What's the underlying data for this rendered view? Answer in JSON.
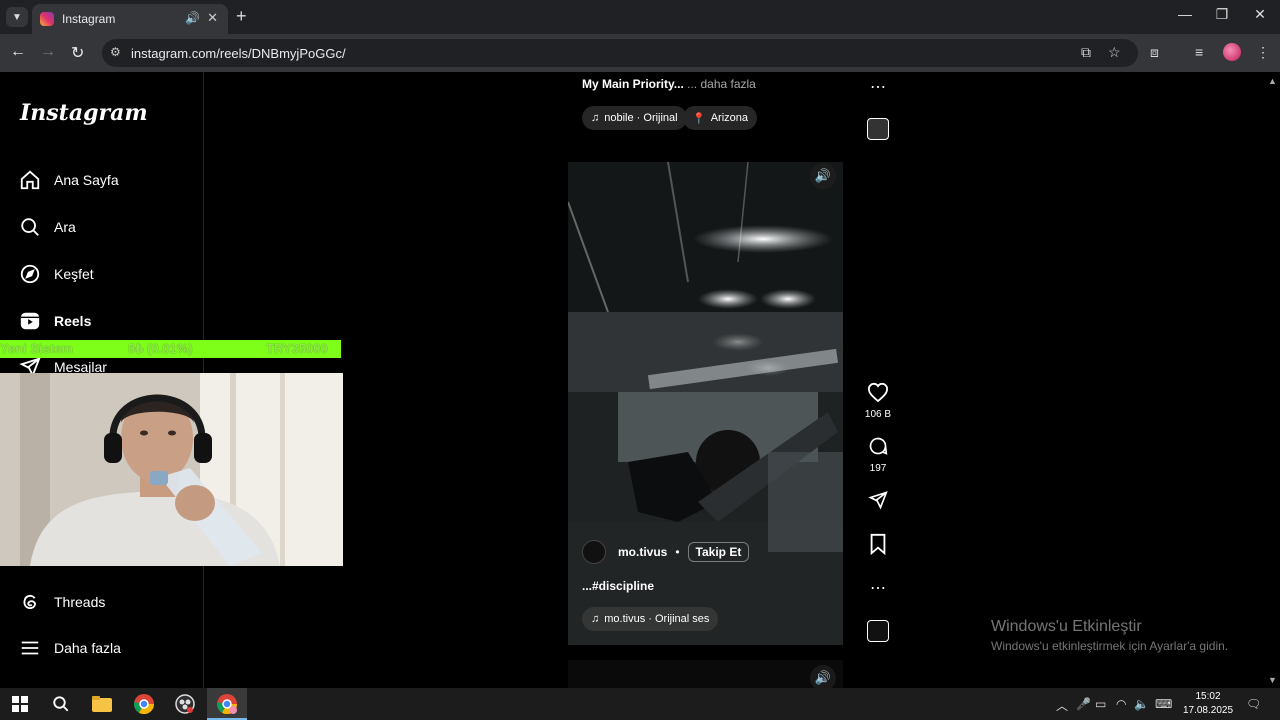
{
  "browser": {
    "tab_title": "Instagram",
    "tab_close": "✕",
    "new_tab": "+",
    "url": "instagram.com/reels/DNBmyjPoGGc/"
  },
  "sidebar": {
    "logo": "Instagram",
    "items": [
      {
        "label": "Ana Sayfa",
        "icon": "home-icon"
      },
      {
        "label": "Ara",
        "icon": "search-icon"
      },
      {
        "label": "Keşfet",
        "icon": "compass-icon"
      },
      {
        "label": "Reels",
        "icon": "reels-icon"
      },
      {
        "label": "Mesajlar",
        "icon": "send-icon"
      },
      {
        "label": "Threads",
        "icon": "threads-icon"
      },
      {
        "label": "Daha fazla",
        "icon": "menu-icon"
      }
    ]
  },
  "ticker": {
    "name": "Yeni Sistem",
    "change": "5₺ (0.01%)",
    "target": "TRY35000"
  },
  "reel_prev": {
    "caption": "My Main Priority... ",
    "more": "... daha fazla",
    "audio": "nobile · Orijinal",
    "location": "Arizona"
  },
  "reel": {
    "author": "mo.tivus",
    "separator": "•",
    "follow": "Takip Et",
    "caption": "...#discipline",
    "audio": "mo.tivus · Orijinal ses",
    "likes": "106 B",
    "comments": "197"
  },
  "watermark": {
    "title": "Windows'u Etkinleştir",
    "subtitle": "Windows'u etkinleştirmek için Ayarlar'a gidin."
  },
  "taskbar": {
    "time": "15:02",
    "date": "17.08.2025"
  },
  "colors": {
    "ticker_bg": "#7dff1a",
    "ig_bg": "#000000",
    "chrome_dark": "#202124"
  }
}
